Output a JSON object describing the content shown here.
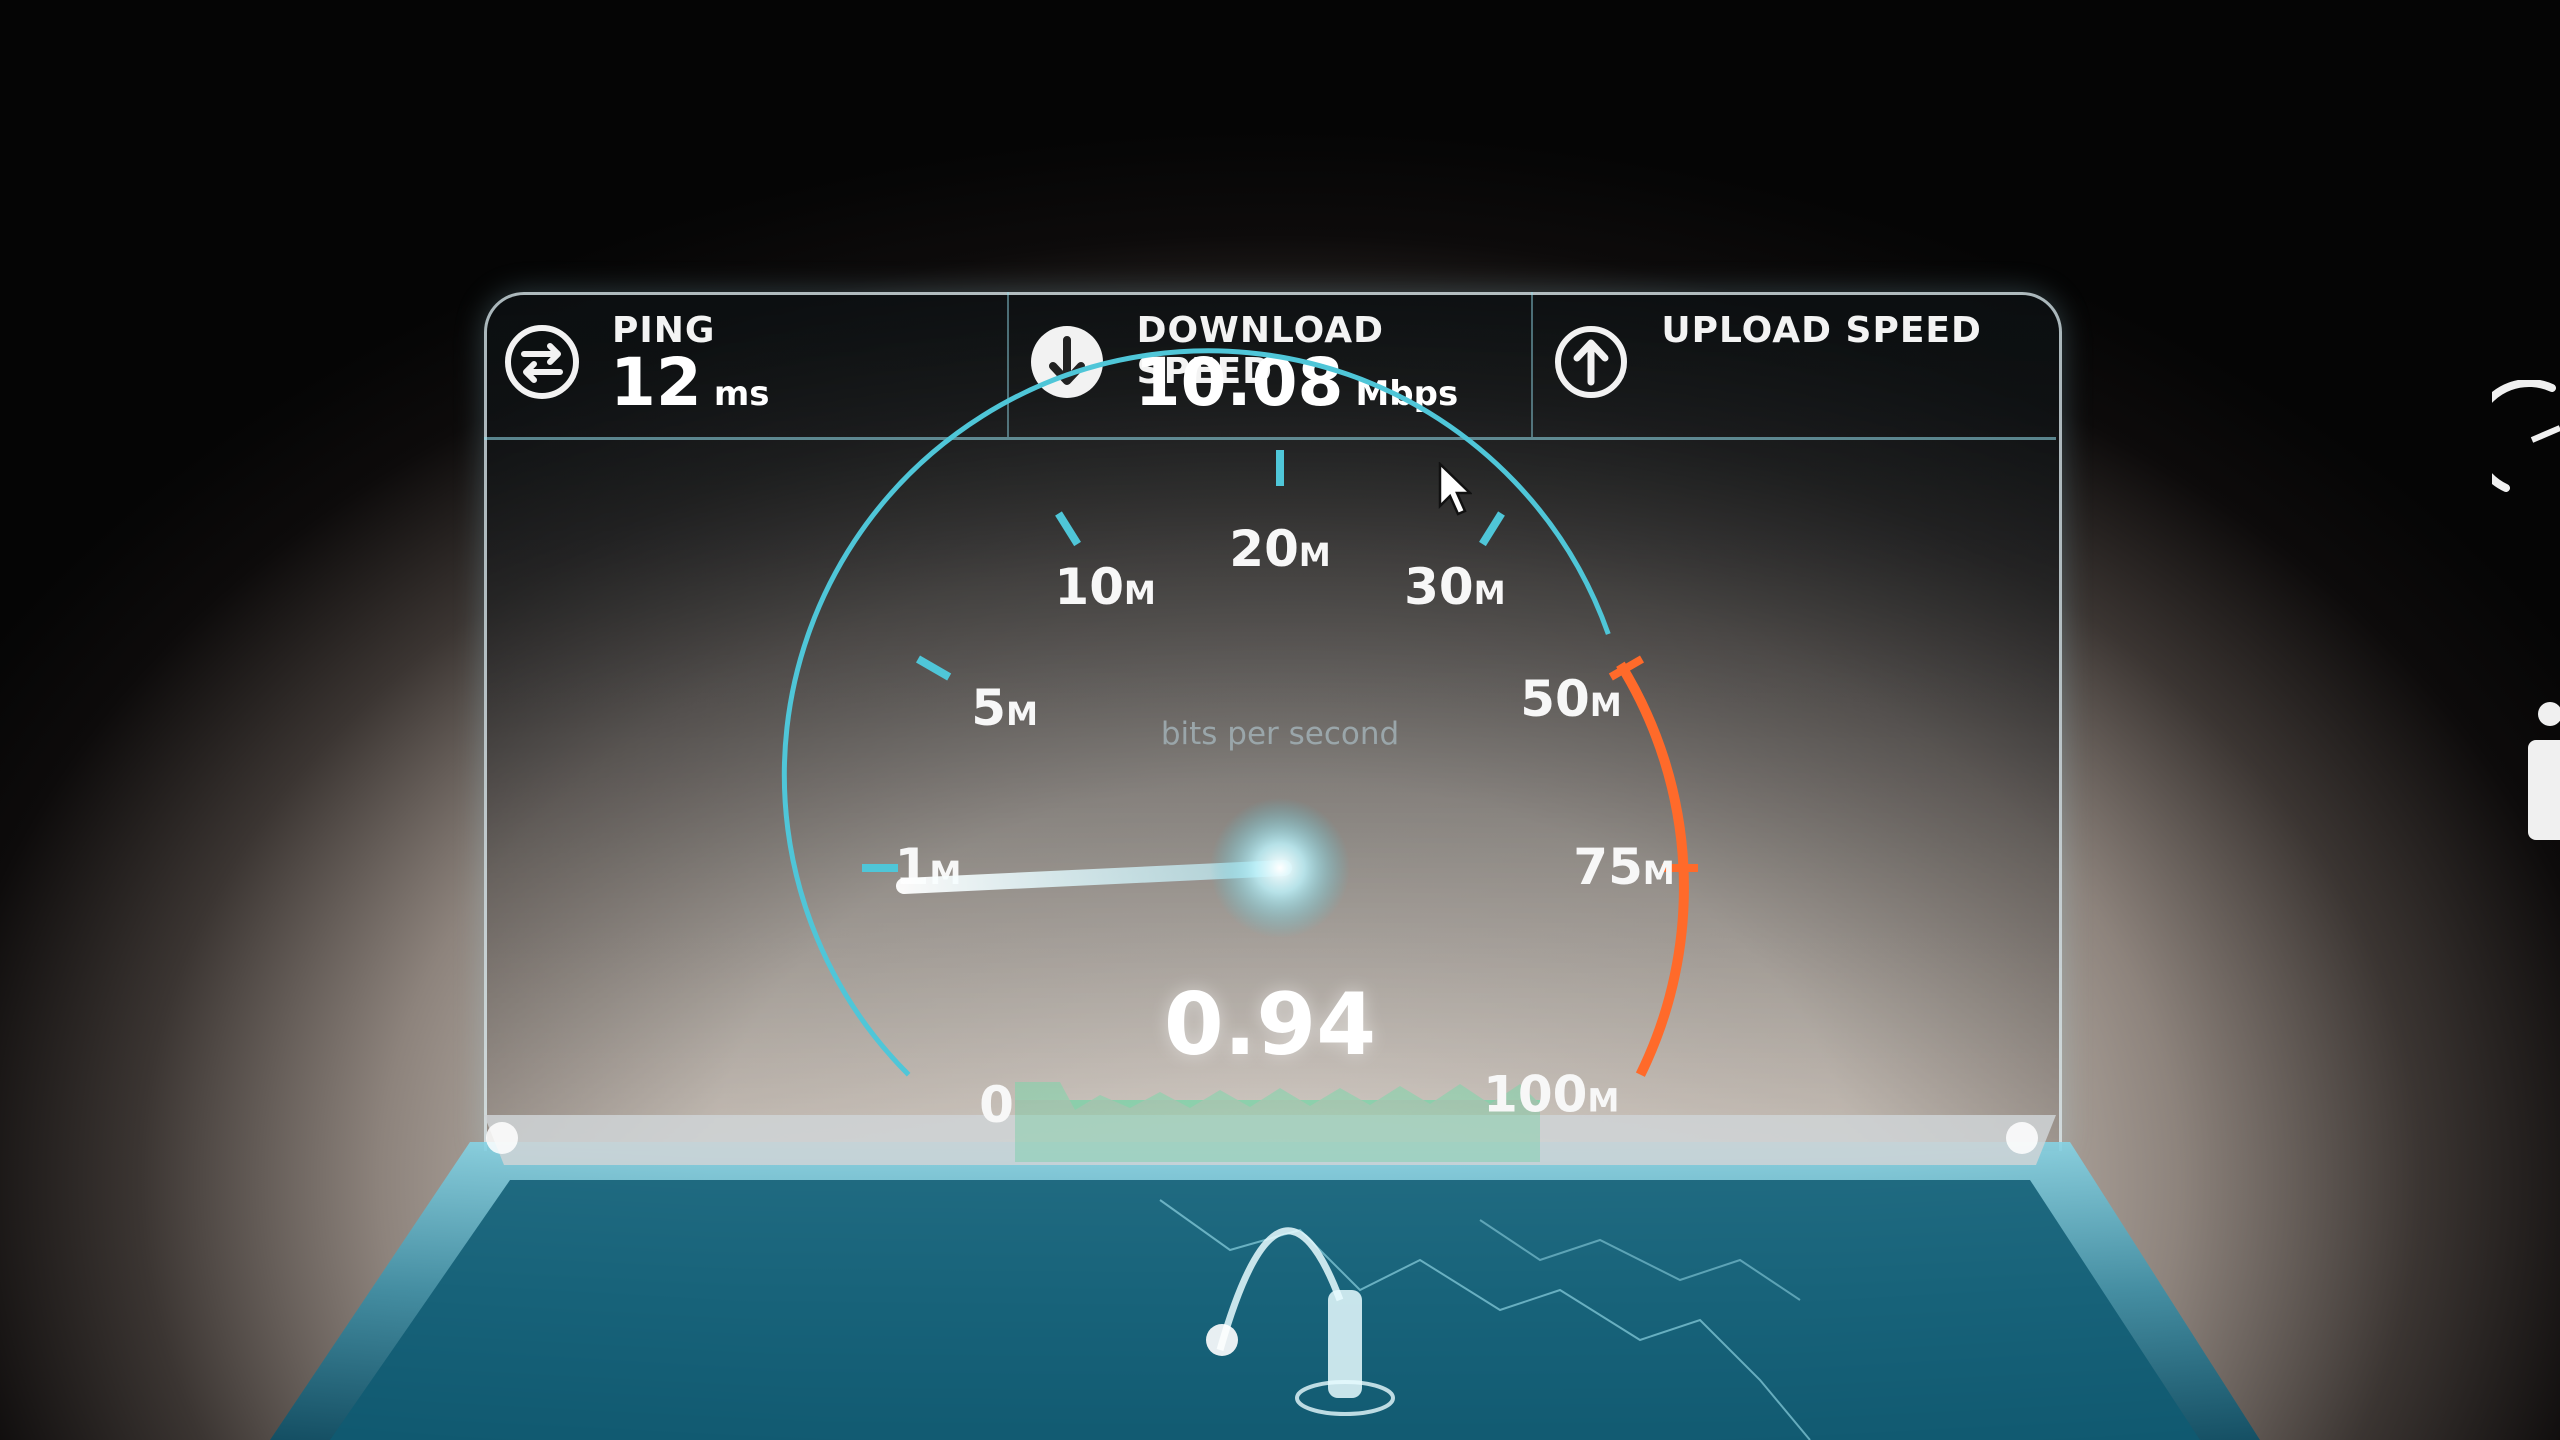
{
  "ping": {
    "label": "PING",
    "value": "12",
    "unit": "ms",
    "icon": "swap-arrows-icon"
  },
  "download": {
    "label": "DOWNLOAD SPEED",
    "value": "10.08",
    "unit": "Mbps",
    "icon": "arrow-down-icon"
  },
  "upload": {
    "label": "UPLOAD SPEED",
    "value": "",
    "unit": "",
    "icon": "arrow-up-icon"
  },
  "gauge": {
    "caption": "bits per second",
    "current_value": "0.94",
    "current_value_number": 0.94,
    "ticks": [
      {
        "label": "0",
        "suffix": ""
      },
      {
        "label": "1",
        "suffix": "M"
      },
      {
        "label": "5",
        "suffix": "M"
      },
      {
        "label": "10",
        "suffix": "M"
      },
      {
        "label": "20",
        "suffix": "M"
      },
      {
        "label": "30",
        "suffix": "M"
      },
      {
        "label": "50",
        "suffix": "M"
      },
      {
        "label": "75",
        "suffix": "M"
      },
      {
        "label": "100",
        "suffix": "M"
      }
    ],
    "colors": {
      "low_arc": "#4fc6d8",
      "high_arc": "#ff6a2a",
      "needle": "#e8fdff"
    }
  },
  "colors": {
    "accent": "#8fe3f0",
    "background": "#0b0b0b"
  }
}
